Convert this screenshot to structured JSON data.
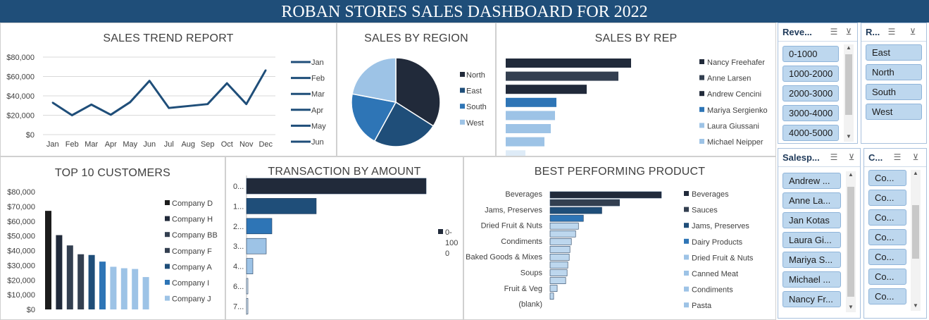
{
  "banner": {
    "title": "ROBAN STORES SALES DASHBOARD FOR 2022"
  },
  "colors": {
    "banner": "#1f4e79",
    "slicer_selected": "#bdd7ee",
    "series_dark": "#212a3a",
    "series_blue": "#2e75b6",
    "series_light": "#9dc3e6"
  },
  "panels": {
    "trend": {
      "title": "SALES TREND REPORT"
    },
    "region": {
      "title": "SALES BY REGION"
    },
    "rep": {
      "title": "SALES BY REP"
    },
    "customers": {
      "title": "TOP 10 CUSTOMERS"
    },
    "transaction": {
      "title": "TRANSACTION BY AMOUNT"
    },
    "product": {
      "title": "BEST PERFORMING PRODUCT"
    }
  },
  "chart_data": [
    {
      "id": "trend",
      "type": "line",
      "title": "SALES TREND REPORT",
      "categories": [
        "Jan",
        "Feb",
        "Mar",
        "Apr",
        "May",
        "Jun",
        "Jul",
        "Aug",
        "Sep",
        "Oct",
        "Nov",
        "Dec"
      ],
      "values": [
        33000,
        20000,
        31000,
        20500,
        33500,
        55500,
        27500,
        29500,
        31500,
        53000,
        31500,
        66500
      ],
      "y_ticks": [
        "$0",
        "$20,000",
        "$40,000",
        "$60,000",
        "$80,000"
      ],
      "ylim": [
        0,
        80000
      ],
      "grid": true,
      "color": "#1f4e79",
      "legend": {
        "position": "right",
        "entries": [
          "Jan",
          "Feb",
          "Mar",
          "Apr",
          "May",
          "Jun"
        ]
      }
    },
    {
      "id": "region",
      "type": "pie",
      "title": "SALES BY REGION",
      "labels": [
        "North",
        "East",
        "South",
        "West"
      ],
      "values": [
        34,
        24,
        20,
        22
      ],
      "colors": [
        "#212a3a",
        "#1f4e79",
        "#2e75b6",
        "#9dc3e6"
      ],
      "legend": {
        "position": "right"
      }
    },
    {
      "id": "rep",
      "type": "bar",
      "title": "SALES BY REP",
      "orientation": "horizontal",
      "values": [
        178,
        160,
        115,
        72,
        70,
        64,
        55,
        28
      ],
      "colors": [
        "#212a3a",
        "#333f50",
        "#212a3a",
        "#2e75b6",
        "#9dc3e6",
        "#9dc3e6",
        "#9dc3e6",
        "#deebf7"
      ],
      "legend": {
        "position": "right",
        "entries": [
          "Nancy Freehafer",
          "Anne Larsen",
          "Andrew Cencini",
          "Mariya Sergienko",
          "Laura Giussani",
          "Michael Neipper"
        ],
        "colors": [
          "#212a3a",
          "#333f50",
          "#212a3a",
          "#2e75b6",
          "#9dc3e6",
          "#9dc3e6"
        ]
      }
    },
    {
      "id": "customers",
      "type": "bar",
      "title": "TOP 10 CUSTOMERS",
      "values": [
        67000,
        50500,
        43500,
        37500,
        37000,
        32500,
        29000,
        28000,
        27500,
        22000
      ],
      "colors": [
        "#1c1c1c",
        "#212a3a",
        "#333f50",
        "#333f50",
        "#1f4e79",
        "#2e75b6",
        "#9dc3e6",
        "#9dc3e6",
        "#9dc3e6",
        "#9dc3e6"
      ],
      "y_ticks": [
        "$0",
        "$10,000",
        "$20,000",
        "$30,000",
        "$40,000",
        "$50,000",
        "$60,000",
        "$70,000",
        "$80,000"
      ],
      "ylim": [
        0,
        80000
      ],
      "legend": {
        "position": "right",
        "entries": [
          "Company D",
          "Company H",
          "Company BB",
          "Company F",
          "Company A",
          "Company I",
          "Company J"
        ],
        "colors": [
          "#1c1c1c",
          "#212a3a",
          "#333f50",
          "#333f50",
          "#1f4e79",
          "#2e75b6",
          "#9dc3e6"
        ]
      }
    },
    {
      "id": "transaction",
      "type": "bar",
      "title": "TRANSACTION BY AMOUNT",
      "orientation": "horizontal",
      "categories": [
        "0...",
        "1...",
        "2...",
        "3...",
        "4...",
        "6...",
        "7..."
      ],
      "values": [
        255,
        99,
        36,
        28,
        9,
        2,
        1
      ],
      "colors": [
        "#212a3a",
        "#1f4e79",
        "#2e75b6",
        "#9dc3e6",
        "#9dc3e6",
        "#deebf7",
        "#deebf7"
      ],
      "legend": {
        "position": "right",
        "lines": [
          "0-",
          "100",
          "0"
        ]
      }
    },
    {
      "id": "product",
      "type": "bar",
      "title": "BEST PERFORMING PRODUCT",
      "orientation": "horizontal",
      "category_labels": [
        "Beverages",
        "Jams, Preserves",
        "Dried Fruit & Nuts",
        "Condiments",
        "Baked Goods & Mixes",
        "Soups",
        "Fruit & Veg",
        "(blank)"
      ],
      "values": [
        157,
        98,
        73,
        47,
        40,
        36,
        30,
        28,
        27,
        25,
        24,
        22,
        10,
        5
      ],
      "colors": [
        "#212a3a",
        "#333f50",
        "#1f4e79",
        "#2e75b6",
        "#bdd7ee",
        "#bdd7ee",
        "#bdd7ee",
        "#bdd7ee",
        "#bdd7ee",
        "#bdd7ee",
        "#bdd7ee",
        "#bdd7ee",
        "#bdd7ee",
        "#bdd7ee"
      ],
      "legend": {
        "position": "right",
        "entries": [
          "Beverages",
          "Sauces",
          "Jams, Preserves",
          "Dairy Products",
          "Dried Fruit & Nuts",
          "Canned Meat",
          "Condiments",
          "Pasta"
        ],
        "colors": [
          "#212a3a",
          "#333f50",
          "#1f4e79",
          "#2e75b6",
          "#9dc3e6",
          "#9dc3e6",
          "#9dc3e6",
          "#9dc3e6"
        ]
      }
    }
  ],
  "slicers": [
    {
      "id": "revenue",
      "title": "Reve...",
      "items": [
        "0-1000",
        "1000-2000",
        "2000-3000",
        "3000-4000",
        "4000-5000"
      ]
    },
    {
      "id": "region",
      "title": "R...",
      "items": [
        "East",
        "North",
        "South",
        "West"
      ]
    },
    {
      "id": "salesperson",
      "title": "Salesp...",
      "items": [
        "Andrew ...",
        "Anne La...",
        "Jan Kotas",
        "Laura Gi...",
        "Mariya S...",
        "Michael ...",
        "Nancy Fr..."
      ]
    },
    {
      "id": "customer",
      "title": "C...",
      "items": [
        "Co...",
        "Co...",
        "Co...",
        "Co...",
        "Co...",
        "Co...",
        "Co..."
      ]
    }
  ]
}
